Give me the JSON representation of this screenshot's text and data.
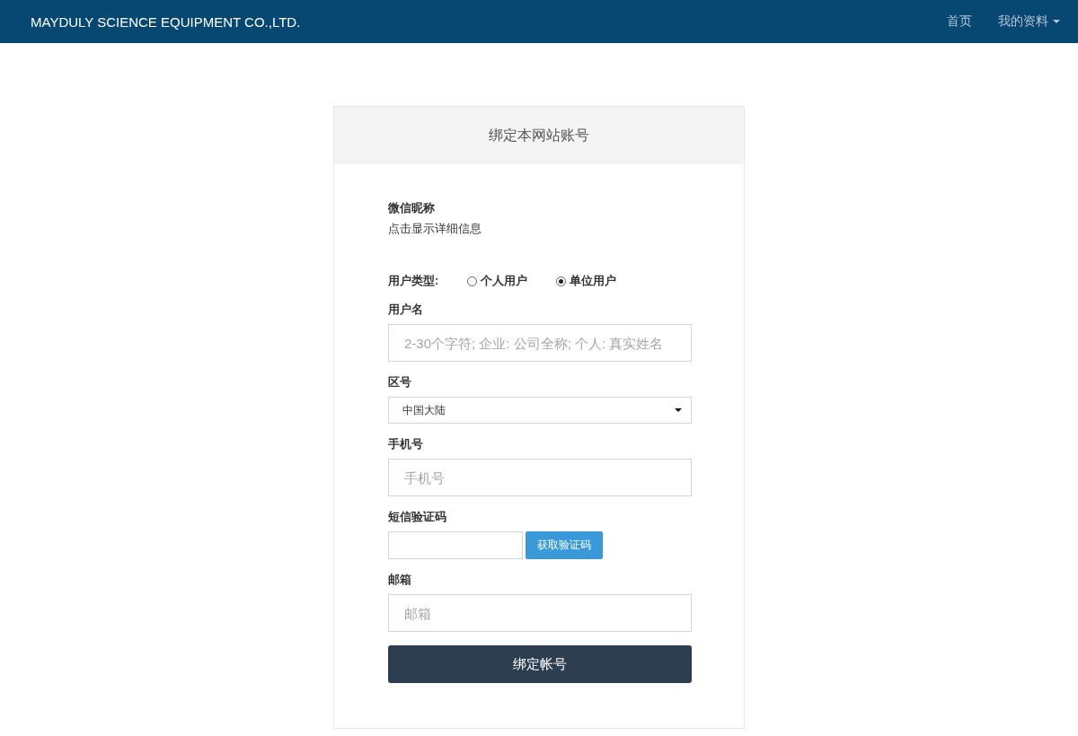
{
  "navbar": {
    "brand": "MAYDULY SCIENCE EQUIPMENT CO.,LTD.",
    "links": [
      {
        "label": "首页",
        "dropdown": false
      },
      {
        "label": "我的资料",
        "dropdown": true
      }
    ]
  },
  "card": {
    "title": "绑定本网站账号",
    "profile": {
      "label": "微信昵称",
      "value": "点击显示详细信息"
    },
    "user_type": {
      "label": "用户类型:",
      "options": [
        {
          "label": "个人用户",
          "selected": false
        },
        {
          "label": "单位用户",
          "selected": true
        }
      ]
    },
    "fields": [
      {
        "kind": "text",
        "label": "用户名",
        "placeholder": "2-30个字符; 企业: 公司全称; 个人: 真实姓名"
      },
      {
        "kind": "select",
        "label": "区号",
        "value": "中国大陆"
      },
      {
        "kind": "text",
        "label": "手机号",
        "placeholder": "手机号"
      },
      {
        "kind": "code",
        "label": "短信验证码",
        "button": "获取验证码"
      },
      {
        "kind": "text",
        "label": "邮箱",
        "placeholder": "邮箱"
      }
    ],
    "submit": "绑定帐号"
  }
}
